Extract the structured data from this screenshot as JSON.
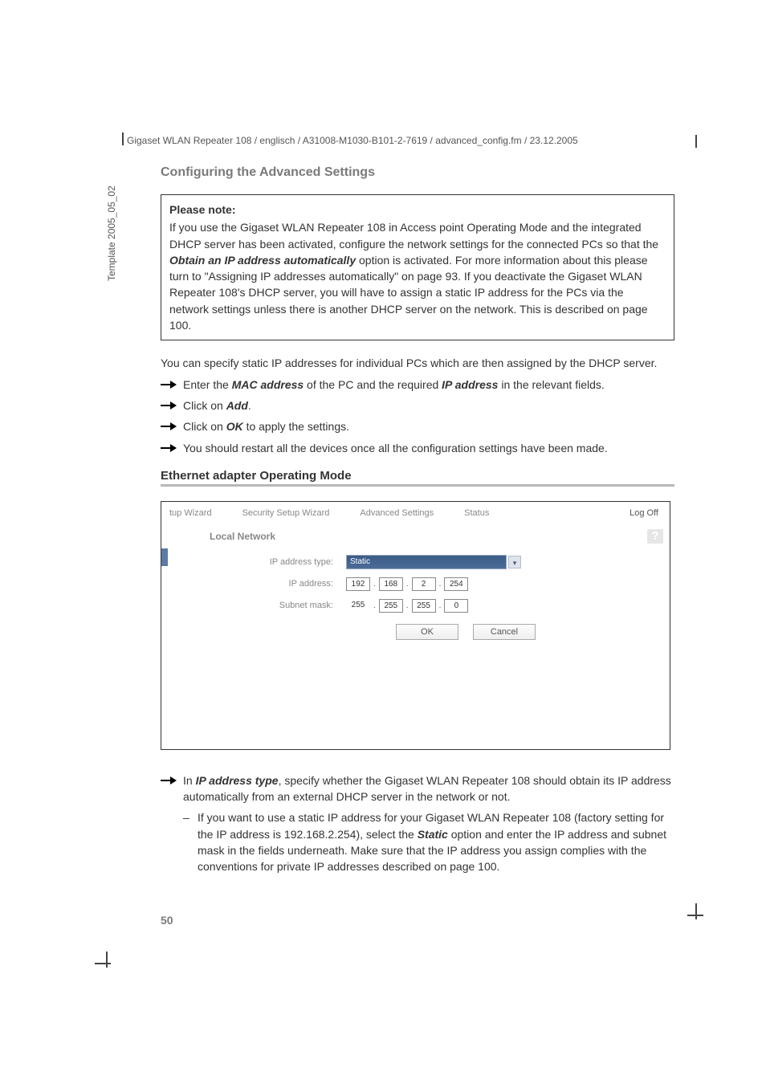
{
  "header": {
    "path": "Gigaset WLAN Repeater 108 / englisch / A31008-M1030-B101-2-7619 / advanced_config.fm / 23.12.2005"
  },
  "sidebar": {
    "template": "Template 2005_05_02"
  },
  "section_title": "Configuring the Advanced Settings",
  "note": {
    "title": "Please note:",
    "body": "If you use the Gigaset WLAN Repeater 108 in Access point Operating Mode and the integrated DHCP server has been activated, configure the network settings for the connected PCs so that the ",
    "bold1": "Obtain an IP address automatically",
    "body2": " option is activated. For more information about this please turn to \"Assigning IP addresses automatically\" on page 93. If you deactivate the Gigaset WLAN Repeater 108's DHCP server, you will have to assign a static IP address for the PCs via the network settings unless there is another DHCP server on the network. This is described on page 100."
  },
  "para1": "You can specify static IP addresses for individual PCs which are then assigned by the DHCP server.",
  "bullets": {
    "b1a": "Enter the ",
    "b1b": "MAC address",
    "b1c": " of the PC and the required ",
    "b1d": "IP address",
    "b1e": " in the relevant fields.",
    "b2a": "Click on ",
    "b2b": "Add",
    "b2c": ".",
    "b3a": "Click on ",
    "b3b": "OK",
    "b3c": " to apply the settings.",
    "b4": "You should restart all the devices once all the configuration settings have been made."
  },
  "subsection": "Ethernet adapter Operating Mode",
  "screenshot": {
    "tabs": {
      "t1": "tup Wizard",
      "t2": "Security Setup Wizard",
      "t3": "Advanced Settings",
      "t4": "Status"
    },
    "logoff": "Log Off",
    "panel_title": "Local Network",
    "help": "?",
    "labels": {
      "ip_type": "IP address type:",
      "ip_addr": "IP address:",
      "subnet": "Subnet mask:"
    },
    "ip_type_value": "Static",
    "ip": {
      "o1": "192",
      "o2": "168",
      "o3": "2",
      "o4": "254"
    },
    "mask": {
      "o1": "255",
      "o2": "255",
      "o3": "255",
      "o4": "0"
    },
    "buttons": {
      "ok": "OK",
      "cancel": "Cancel"
    }
  },
  "bottom": {
    "b1a": "In ",
    "b1b": "IP address type",
    "b1c": ", specify whether the Gigaset WLAN Repeater 108 should obtain its IP address automatically from an external DHCP server in the network or not.",
    "sub_a": "If you want to use a static IP address for your Gigaset WLAN Repeater 108 (factory setting for the IP address is 192.168.2.254), select the ",
    "sub_b": "Static",
    "sub_c": " option and enter the IP address and subnet mask in the fields underneath. Make sure that the IP address you assign complies with the conventions for private IP addresses described on page 100."
  },
  "page_number": "50"
}
